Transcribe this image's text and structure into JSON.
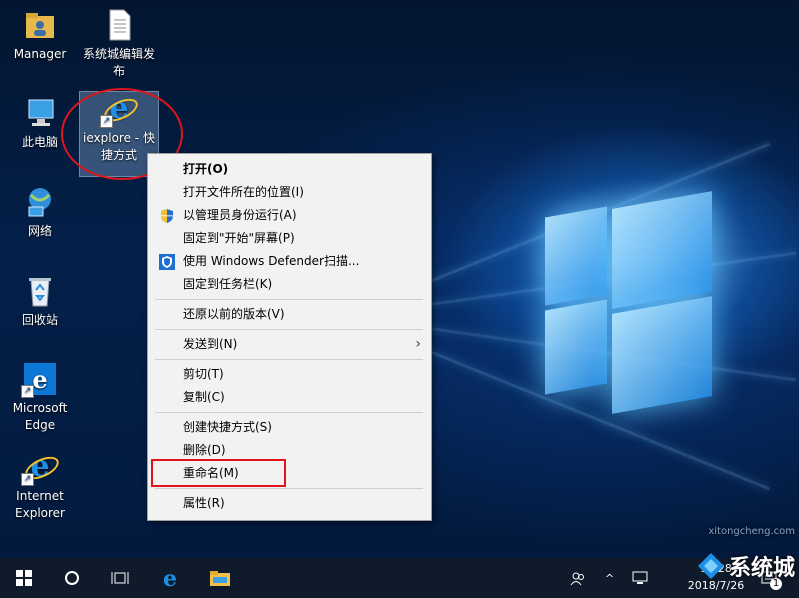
{
  "desktop": {
    "icons": [
      {
        "label": "Manager"
      },
      {
        "label": "系统城编辑发布"
      },
      {
        "label": "此电脑"
      },
      {
        "label": "iexplore - 快捷方式"
      },
      {
        "label": "网络"
      },
      {
        "label": "回收站"
      },
      {
        "label": "Microsoft Edge"
      },
      {
        "label": "Internet Explorer"
      }
    ]
  },
  "context_menu": {
    "items": [
      {
        "label": "打开(O)"
      },
      {
        "label": "打开文件所在的位置(I)"
      },
      {
        "label": "以管理员身份运行(A)"
      },
      {
        "label": "固定到\"开始\"屏幕(P)"
      },
      {
        "label": "使用 Windows Defender扫描..."
      },
      {
        "label": "固定到任务栏(K)"
      },
      {
        "label": "还原以前的版本(V)"
      },
      {
        "label": "发送到(N)"
      },
      {
        "label": "剪切(T)"
      },
      {
        "label": "复制(C)"
      },
      {
        "label": "创建快捷方式(S)"
      },
      {
        "label": "删除(D)"
      },
      {
        "label": "重命名(M)"
      },
      {
        "label": "属性(R)"
      }
    ],
    "submenu_arrow": "›"
  },
  "taskbar": {
    "time": "15:28",
    "date": "2018/7/26",
    "notification_count": "1"
  },
  "watermark": {
    "text": "系统城",
    "url": "xitongcheng.com"
  },
  "colors": {
    "highlight_red": "#e0161b",
    "taskbar": "#0f1a2b",
    "menu_bg": "#f2f2f2"
  }
}
